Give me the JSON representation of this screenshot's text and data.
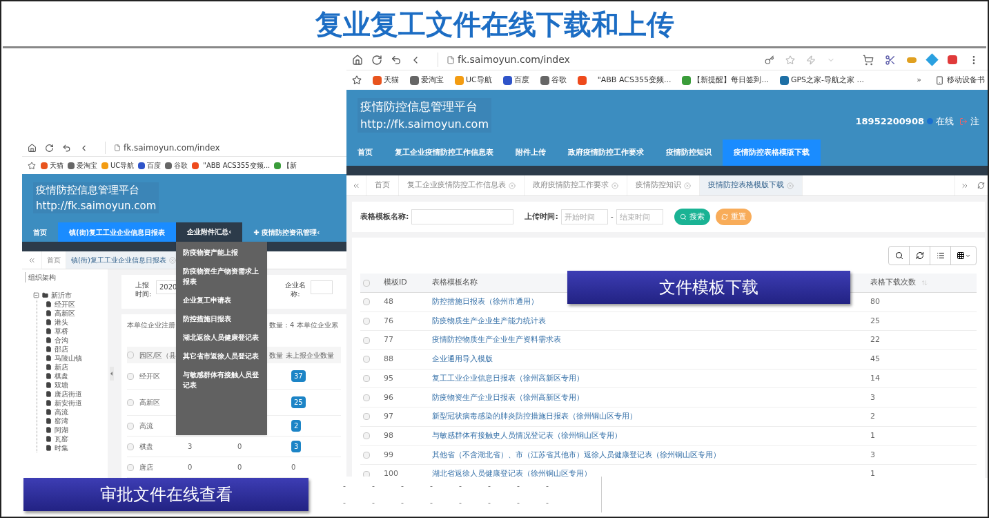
{
  "slide_title": "复业复工文件在线下载和上传",
  "left_screenshot": {
    "url": "fk.saimoyun.com/index",
    "bookmarks": [
      {
        "label": "天猫",
        "color": "#e8541e"
      },
      {
        "label": "爱淘宝",
        "color": "#666666"
      },
      {
        "label": "UC导航",
        "color": "#f39c12"
      },
      {
        "label": "百度",
        "color": "#2f54c9"
      },
      {
        "label": "谷歌",
        "color": "#666666"
      },
      {
        "color": "#ee4a1c"
      },
      {
        "label": "\"ABB ACS355变频..."
      },
      {
        "label": "【新",
        "color": "#3a9c3a"
      }
    ],
    "site_title": "疫情防控信息管理平台",
    "site_url": "http://fk.saimoyun.com",
    "nav": [
      {
        "label": "首页",
        "selected": false,
        "open": false
      },
      {
        "label": "镇(街)复工工业企业信息日报表",
        "selected": true,
        "open": false
      },
      {
        "label": "企业附件汇总‹",
        "selected": false,
        "open": true
      },
      {
        "label": "✚ 疫情防控资讯管理‹",
        "selected": false,
        "open": false
      }
    ],
    "tabs": [
      {
        "label": "首页",
        "selected": false,
        "closable": false
      },
      {
        "label": "镇(街)复工工业企业信息日报表",
        "selected": true,
        "closable": true
      }
    ],
    "dropdown": [
      "防疫物资产能上报",
      "防疫物资生产物资需求上报表",
      "企业复工申请表",
      "防控措施日报表",
      "湖北返徐人员健康登记表",
      "其它省市返徐人员登记表",
      "与敏感群体有接触人员登记表"
    ],
    "sidebar": {
      "title": "组织架构",
      "tree": [
        {
          "label": "新沂市",
          "expanded": true,
          "children": [
            {
              "label": "经开区"
            },
            {
              "label": "高新区"
            },
            {
              "label": "港头"
            },
            {
              "label": "草桥"
            },
            {
              "label": "合沟"
            },
            {
              "label": "邵店"
            },
            {
              "label": "马陵山镇"
            },
            {
              "label": "新店"
            },
            {
              "label": "棋盘"
            },
            {
              "label": "双塘"
            },
            {
              "label": "唐店街道"
            },
            {
              "label": "新安街道"
            },
            {
              "label": "高流"
            },
            {
              "label": "窑湾"
            },
            {
              "label": "阿湖"
            },
            {
              "label": "瓦窑"
            },
            {
              "label": "时集"
            }
          ]
        }
      ]
    },
    "form": {
      "date_label": "上报时间:",
      "date_value": "2020",
      "company_label": "企业名称:"
    },
    "summary": [
      "本单位企业注册",
      "数量：4 本单位企业累"
    ],
    "table": {
      "header_checked": false,
      "columns": [
        "园区/区（县",
        "数量",
        "未上报企业数量"
      ],
      "rows": [
        {
          "name": "经开区",
          "unreported": "37",
          "highlighted": true,
          "checked": false
        },
        {
          "name": "高新区",
          "unreported": "25",
          "highlighted": true,
          "checked": false
        },
        {
          "name": "高流",
          "unreported": "2",
          "highlighted": true,
          "checked": false
        },
        {
          "name": "棋盘",
          "col_2": "3",
          "col_3": "0",
          "unreported": "3",
          "highlighted": true,
          "checked": false
        },
        {
          "name": "唐店",
          "col_2": "0",
          "col_3": "0",
          "unreported": "0",
          "highlighted": false,
          "checked": false
        }
      ]
    }
  },
  "right_screenshot": {
    "url": "fk.saimoyun.com/index",
    "bookmarks": [
      {
        "label": "天猫",
        "color": "#e8541e"
      },
      {
        "label": "爱淘宝",
        "color": "#666666"
      },
      {
        "label": "UC导航",
        "color": "#f39c12"
      },
      {
        "label": "百度",
        "color": "#2f54c9"
      },
      {
        "label": "谷歌",
        "color": "#666666"
      },
      {
        "color": "#ee4a1c"
      },
      {
        "label": "\"ABB ACS355变频..."
      },
      {
        "label": "【新提醒】每日签到...",
        "color": "#3a9c3a"
      },
      {
        "label": "GPS之家-导航之家 ...",
        "color": "#1d6fa5"
      }
    ],
    "more_bookmarks": "»",
    "mobile_bookmarks": "移动设备书",
    "site_title": "疫情防控信息管理平台",
    "site_url": "http://fk.saimoyun.com",
    "user": {
      "phone": "18952200908",
      "status": "在线",
      "logout": "注"
    },
    "nav": [
      {
        "label": "首页",
        "selected": false
      },
      {
        "label": "复工企业疫情防控工作信息表",
        "selected": false
      },
      {
        "label": "附件上传",
        "selected": false
      },
      {
        "label": "政府疫情防控工作要求",
        "selected": false
      },
      {
        "label": "疫情防控知识",
        "selected": false
      },
      {
        "label": "疫情防控表格模版下载",
        "selected": true
      }
    ],
    "tabs": [
      {
        "label": "首页",
        "selected": false,
        "closable": false
      },
      {
        "label": "复工企业疫情防控工作信息表",
        "selected": false,
        "closable": true
      },
      {
        "label": "政府疫情防控工作要求",
        "selected": false,
        "closable": true
      },
      {
        "label": "疫情防控知识",
        "selected": false,
        "closable": true
      },
      {
        "label": "疫情防控表格模版下载",
        "selected": true,
        "closable": true
      }
    ],
    "search": {
      "name_label": "表格模板名称:",
      "time_label": "上传时间:",
      "start_placeholder": "开始时间",
      "separator": "-",
      "end_placeholder": "结束时间",
      "search_button": "搜索",
      "reset_button": "重置"
    },
    "table": {
      "header_checked": false,
      "columns": [
        "模板ID",
        "表格模板名称",
        "表格下载次数"
      ],
      "rows": [
        {
          "id": "48",
          "name": "防控措施日报表（徐州市通用）",
          "downloads": "80",
          "checked": false
        },
        {
          "id": "76",
          "name": "防疫物质生产企业生产能力统计表",
          "downloads": "25",
          "checked": false
        },
        {
          "id": "77",
          "name": "疫情防控物质生产企业生产资料需求表",
          "downloads": "22",
          "checked": false
        },
        {
          "id": "88",
          "name": "企业通用导入模版",
          "downloads": "45",
          "checked": false
        },
        {
          "id": "95",
          "name": "复工工业企业信息日报表（徐州高新区专用）",
          "downloads": "14",
          "checked": false
        },
        {
          "id": "96",
          "name": "防疫物资生产企业日报表（徐州高新区专用）",
          "downloads": "3",
          "checked": false
        },
        {
          "id": "97",
          "name": "新型冠状病毒感染的肺炎防控措施日报表（徐州铜山区专用）",
          "downloads": "2",
          "checked": false
        },
        {
          "id": "98",
          "name": "与敏感群体有接触史人员情况登记表（徐州铜山区专用）",
          "downloads": "1",
          "checked": false
        },
        {
          "id": "99",
          "name": "其他省（不含湖北省）、市（江苏省其他市）返徐人员健康登记表（徐州铜山区专用）",
          "downloads": "3",
          "checked": false
        },
        {
          "id": "100",
          "name": "湖北省返徐人员健康登记表（徐州铜山区专用）",
          "downloads": "1",
          "checked": false
        }
      ]
    }
  },
  "lower_strip": {
    "rows": [
      [
        "-",
        "-",
        "-",
        "-",
        "-",
        "-",
        "-",
        "-"
      ],
      [
        "-",
        "-",
        "-",
        "-",
        "-",
        "-",
        "-",
        "-"
      ]
    ]
  },
  "captions": [
    {
      "text": "审批文件在线查看"
    },
    {
      "text": "文件模板下载"
    }
  ]
}
